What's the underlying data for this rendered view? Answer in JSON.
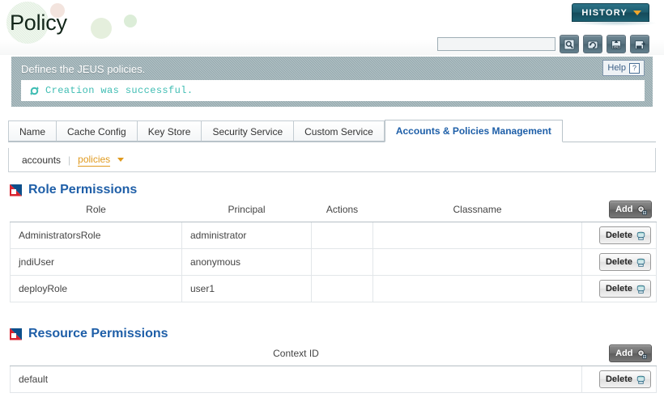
{
  "header": {
    "title": "Policy",
    "history_label": "HISTORY",
    "history_caret_icon": "chevron-down-icon",
    "accent_teal": "#1d5c6d",
    "accent_orange": "#f0a62c"
  },
  "search": {
    "value": "",
    "placeholder": ""
  },
  "toolbar": {
    "buttons": [
      {
        "name": "search-icon",
        "title": "Search"
      },
      {
        "name": "refresh-icon",
        "title": "Refresh"
      },
      {
        "name": "xml-export-icon",
        "title": "Export XML"
      },
      {
        "name": "save-export-icon",
        "title": "Export"
      }
    ]
  },
  "banner": {
    "description": "Defines the JEUS policies.",
    "help_label": "Help",
    "help_icon": "question-mark-icon",
    "message": "Creation was successful.",
    "message_icon": "refresh-success-icon",
    "message_color": "#3fbdb3",
    "background_color": "#93a8ad"
  },
  "tabs": [
    {
      "label": "Name",
      "active": false
    },
    {
      "label": "Cache Config",
      "active": false
    },
    {
      "label": "Key Store",
      "active": false
    },
    {
      "label": "Security Service",
      "active": false
    },
    {
      "label": "Custom Service",
      "active": false
    },
    {
      "label": "Accounts & Policies Management",
      "active": true
    }
  ],
  "subnav": {
    "accounts_label": "accounts",
    "separator": "|",
    "policies_label": "policies",
    "caret_icon": "caret-down-icon",
    "active_color": "#e09a1e"
  },
  "sections": [
    {
      "title": "Role Permissions",
      "icon": "section-marker-icon",
      "add_label": "Add",
      "add_icon": "add-gear-icon",
      "delete_label": "Delete",
      "delete_icon": "trash-icon",
      "columns": [
        "Role",
        "Principal",
        "Actions",
        "Classname"
      ],
      "rows": [
        {
          "Role": "AdministratorsRole",
          "Principal": "administrator",
          "Actions": "",
          "Classname": ""
        },
        {
          "Role": "jndiUser",
          "Principal": "anonymous",
          "Actions": "",
          "Classname": ""
        },
        {
          "Role": "deployRole",
          "Principal": "user1",
          "Actions": "",
          "Classname": ""
        }
      ]
    },
    {
      "title": "Resource Permissions",
      "icon": "section-marker-icon",
      "add_label": "Add",
      "add_icon": "add-gear-icon",
      "delete_label": "Delete",
      "delete_icon": "trash-icon",
      "columns": [
        "Context ID"
      ],
      "rows": [
        {
          "Context ID": "default"
        }
      ]
    }
  ]
}
